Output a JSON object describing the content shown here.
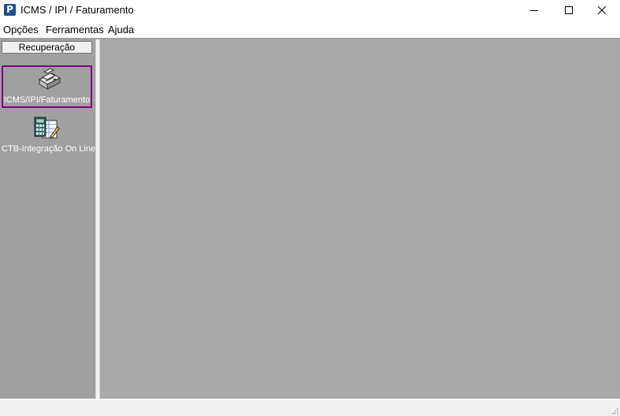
{
  "window": {
    "title": "ICMS / IPI / Faturamento",
    "title_suffix": ".",
    "app_icon_glyph": "P",
    "controls": [
      "minimize-icon",
      "maximize-icon",
      "close-icon"
    ]
  },
  "menu": {
    "items": [
      {
        "label": "Opções"
      },
      {
        "label": "Ferramentas"
      },
      {
        "label": "Ajuda"
      }
    ]
  },
  "sidebar": {
    "header": "Recuperação",
    "items": [
      {
        "label": "ICMS/IPI/Faturamento",
        "icon": "printer-icon",
        "selected": true
      },
      {
        "label": "CTB-Integração On Line",
        "icon": "calculator-spreadsheet-icon",
        "selected": false
      }
    ]
  },
  "colors": {
    "selection_border": "#800080",
    "workspace": "#a9a9a9",
    "sidebar": "#a0a0a0"
  }
}
